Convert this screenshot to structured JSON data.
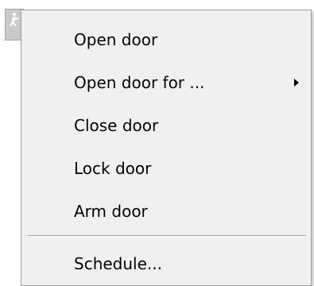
{
  "anchor": {
    "icon": "door-man-icon"
  },
  "menu": {
    "items": [
      {
        "label": "Open door",
        "submenu": false
      },
      {
        "label": "Open door for ...",
        "submenu": true
      },
      {
        "label": "Close door",
        "submenu": false
      },
      {
        "label": "Lock door",
        "submenu": false
      },
      {
        "label": "Arm door",
        "submenu": false
      }
    ],
    "after_separator": [
      {
        "label": "Schedule...",
        "submenu": false
      }
    ]
  },
  "colors": {
    "menu_bg": "#f0f0f0",
    "menu_border": "#a0a0a0",
    "text": "#000000"
  }
}
